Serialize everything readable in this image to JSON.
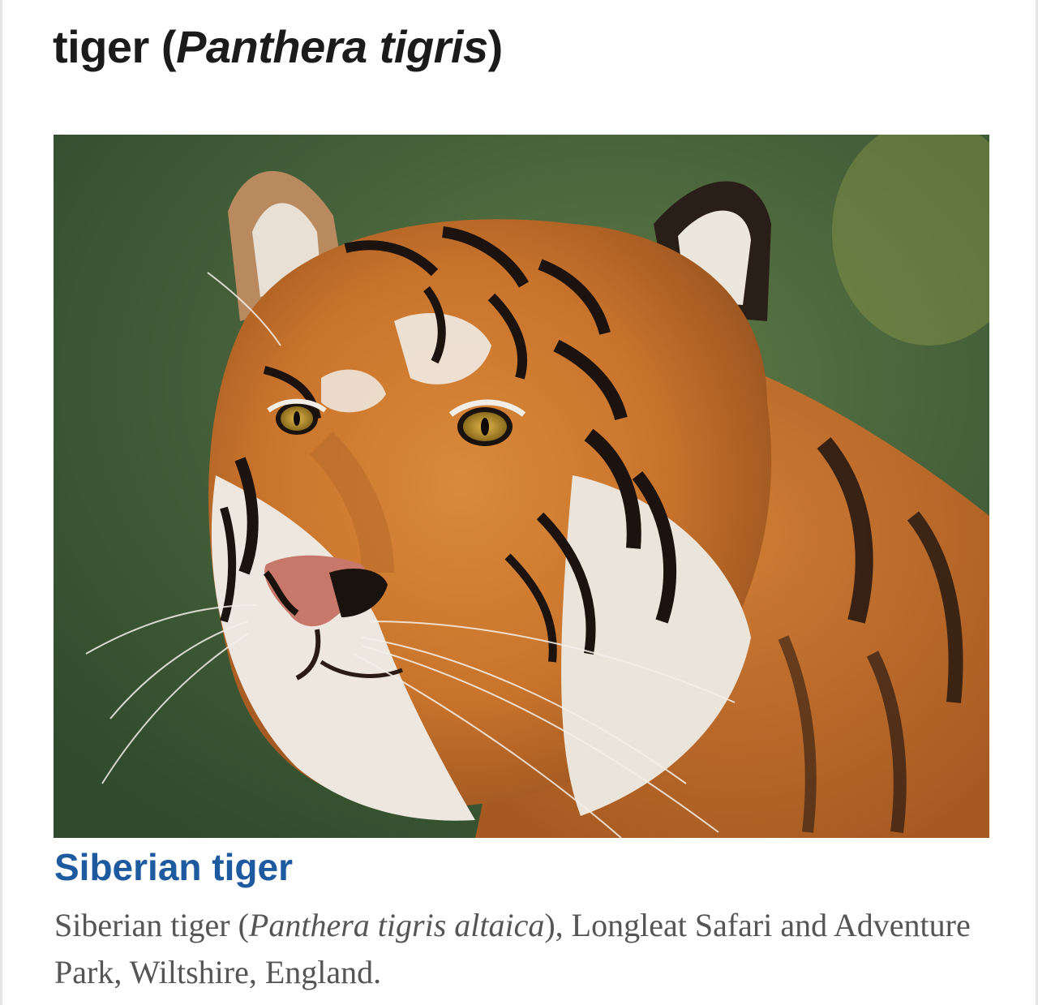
{
  "article": {
    "title_common": "tiger (",
    "title_scientific": "Panthera tigris",
    "title_close": ")"
  },
  "figure": {
    "image_subject": "Siberian tiger portrait",
    "caption_title": "Siberian tiger",
    "caption_pre": "Siberian tiger (",
    "caption_scientific": "Panthera tigris altaica",
    "caption_post": "), Longleat Safari and Adventure Park, Wiltshire, England."
  },
  "colors": {
    "title": "#1b1b1b",
    "link": "#1d5aa0",
    "caption": "#555555",
    "background_green": "#3f5a33",
    "fur_orange": "#c9742c"
  }
}
